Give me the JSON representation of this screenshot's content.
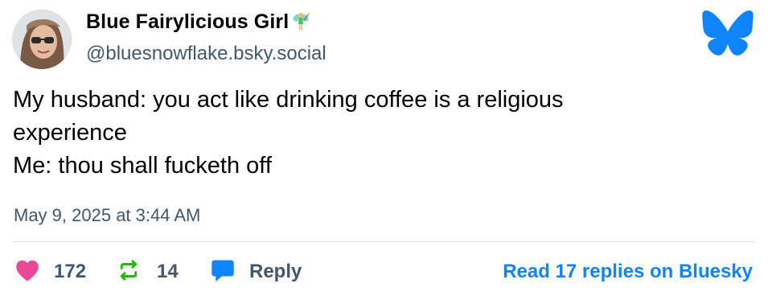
{
  "author": {
    "display_name": "Blue Fairylicious Girl",
    "name_emoji": "fairy-emoji",
    "handle": "@bluesnowflake.bsky.social"
  },
  "post": {
    "lines": [
      "My husband: you act like drinking coffee is a religious",
      "experience",
      "Me: thou shall fucketh off"
    ],
    "timestamp": "May 9, 2025 at 3:44 AM"
  },
  "actions": {
    "likes": "172",
    "reposts": "14",
    "reply_label": "Reply",
    "read_replies_label": "Read 17 replies on Bluesky"
  },
  "colors": {
    "bluesky_blue": "#1083fe",
    "like_pink": "#ec4899",
    "repost_green": "#20bc07",
    "muted_text": "#42576c"
  },
  "icons": [
    "bluesky-butterfly-icon",
    "heart-icon",
    "repost-icon",
    "reply-bubble-icon"
  ]
}
